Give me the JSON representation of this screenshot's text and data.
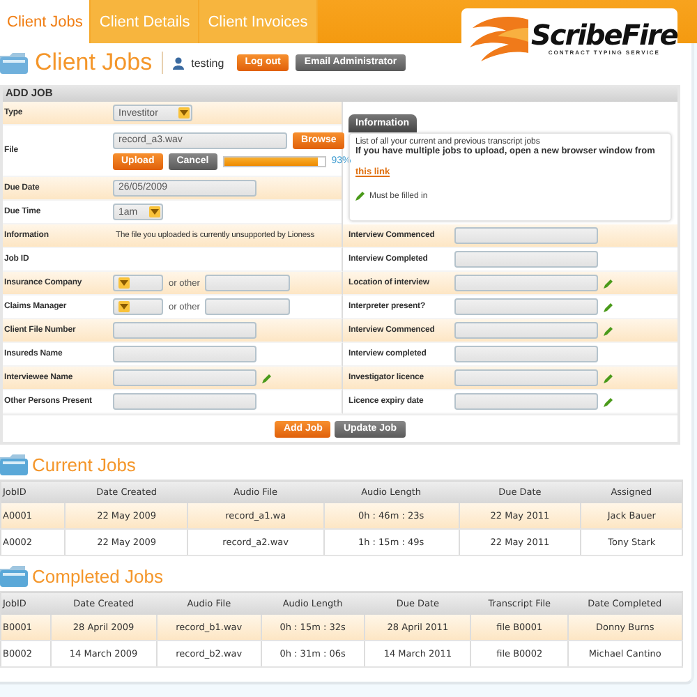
{
  "tabs": [
    {
      "label": "Client Jobs",
      "selected": true
    },
    {
      "label": "Client Details",
      "selected": false
    },
    {
      "label": "Client Invoices",
      "selected": false
    }
  ],
  "logo": {
    "name": "ScribeFire",
    "tagline": "CONTRACT TYPING SERVICE"
  },
  "page_title": "Client Jobs",
  "user": "testing",
  "user_buttons": [
    {
      "label": "Log out",
      "kind": "primary"
    },
    {
      "label": "Email Administrator",
      "kind": "secondary"
    }
  ],
  "add_job": {
    "title": "ADD JOB",
    "top_rows": [
      {
        "label": "Type",
        "kind": "select",
        "value": "Investitor"
      },
      {
        "label": "File",
        "kind": "file",
        "value": "record_a3.wav",
        "browse": "Browse",
        "upload": "Upload",
        "cancel": "Cancel",
        "level": 0.93,
        "reading": "93%"
      },
      {
        "label": "Due Date",
        "kind": "text",
        "value": "26/05/2009"
      },
      {
        "label": "Due Time",
        "kind": "time",
        "value": "1am"
      }
    ],
    "info": {
      "tab": "Information",
      "text": "List of all your current and previous transcript jobs",
      "bold_text": "If you have multiple jobs to upload, open a new browser window from",
      "link": "this link",
      "legend": "Must be filled in"
    },
    "left_rows": [
      {
        "label": "Information",
        "kind": "note",
        "value": "The file you uploaded is currently unsupported by Lioness",
        "required": false
      },
      {
        "label": "Job ID",
        "kind": "empty",
        "required": false
      },
      {
        "label": "Insurance Company",
        "kind": "select-other",
        "other": "or other",
        "required": false
      },
      {
        "label": "Claims Manager",
        "kind": "select-other",
        "other": "or other",
        "required": false
      },
      {
        "label": "Client File Number",
        "kind": "text",
        "required": false
      },
      {
        "label": "Insureds Name",
        "kind": "text",
        "required": false
      },
      {
        "label": "Interviewee Name",
        "kind": "text",
        "required": true
      },
      {
        "label": "Other Persons Present",
        "kind": "text",
        "required": false
      }
    ],
    "right_rows": [
      {
        "label": "Interview Commenced",
        "required": false
      },
      {
        "label": "Interview Completed",
        "required": false
      },
      {
        "label": "Location of interview",
        "required": true
      },
      {
        "label": "Interpreter present?",
        "required": true
      },
      {
        "label": "Interview Commenced",
        "required": true
      },
      {
        "label": "Interview completed",
        "required": false
      },
      {
        "label": "Investigator licence",
        "required": true
      },
      {
        "label": "Licence expiry date",
        "required": true
      }
    ],
    "buttons": [
      {
        "label": "Add Job",
        "kind": "primary"
      },
      {
        "label": "Update Job",
        "kind": "secondary"
      }
    ]
  },
  "current_jobs": {
    "title": "Current Jobs",
    "columns": [
      "JobID",
      "Date Created",
      "Audio File",
      "Audio Length",
      "Due Date",
      "Assigned"
    ],
    "rows": [
      [
        "A0001",
        "22 May 2009",
        "record_a1.wa",
        "0h : 46m : 23s",
        "22 May 2011",
        "Jack Bauer"
      ],
      [
        "A0002",
        "22 May 2009",
        "record_a2.wav",
        "1h : 15m : 49s",
        "22 May 2011",
        "Tony Stark"
      ]
    ]
  },
  "completed_jobs": {
    "title": "Completed Jobs",
    "columns": [
      "JobID",
      "Date Created",
      "Audio File",
      "Audio Length",
      "Due Date",
      "Transcript File",
      "Date Completed"
    ],
    "rows": [
      [
        "B0001",
        "28 April 2009",
        "record_b1.wav",
        "0h : 15m : 32s",
        "28 April 2011",
        "file B0001",
        "Donny Burns"
      ],
      [
        "B0002",
        "14 March 2009",
        "record_b2.wav",
        "0h : 31m : 06s",
        "14 March 2011",
        "file B0002",
        "Michael Cantino"
      ]
    ]
  }
}
